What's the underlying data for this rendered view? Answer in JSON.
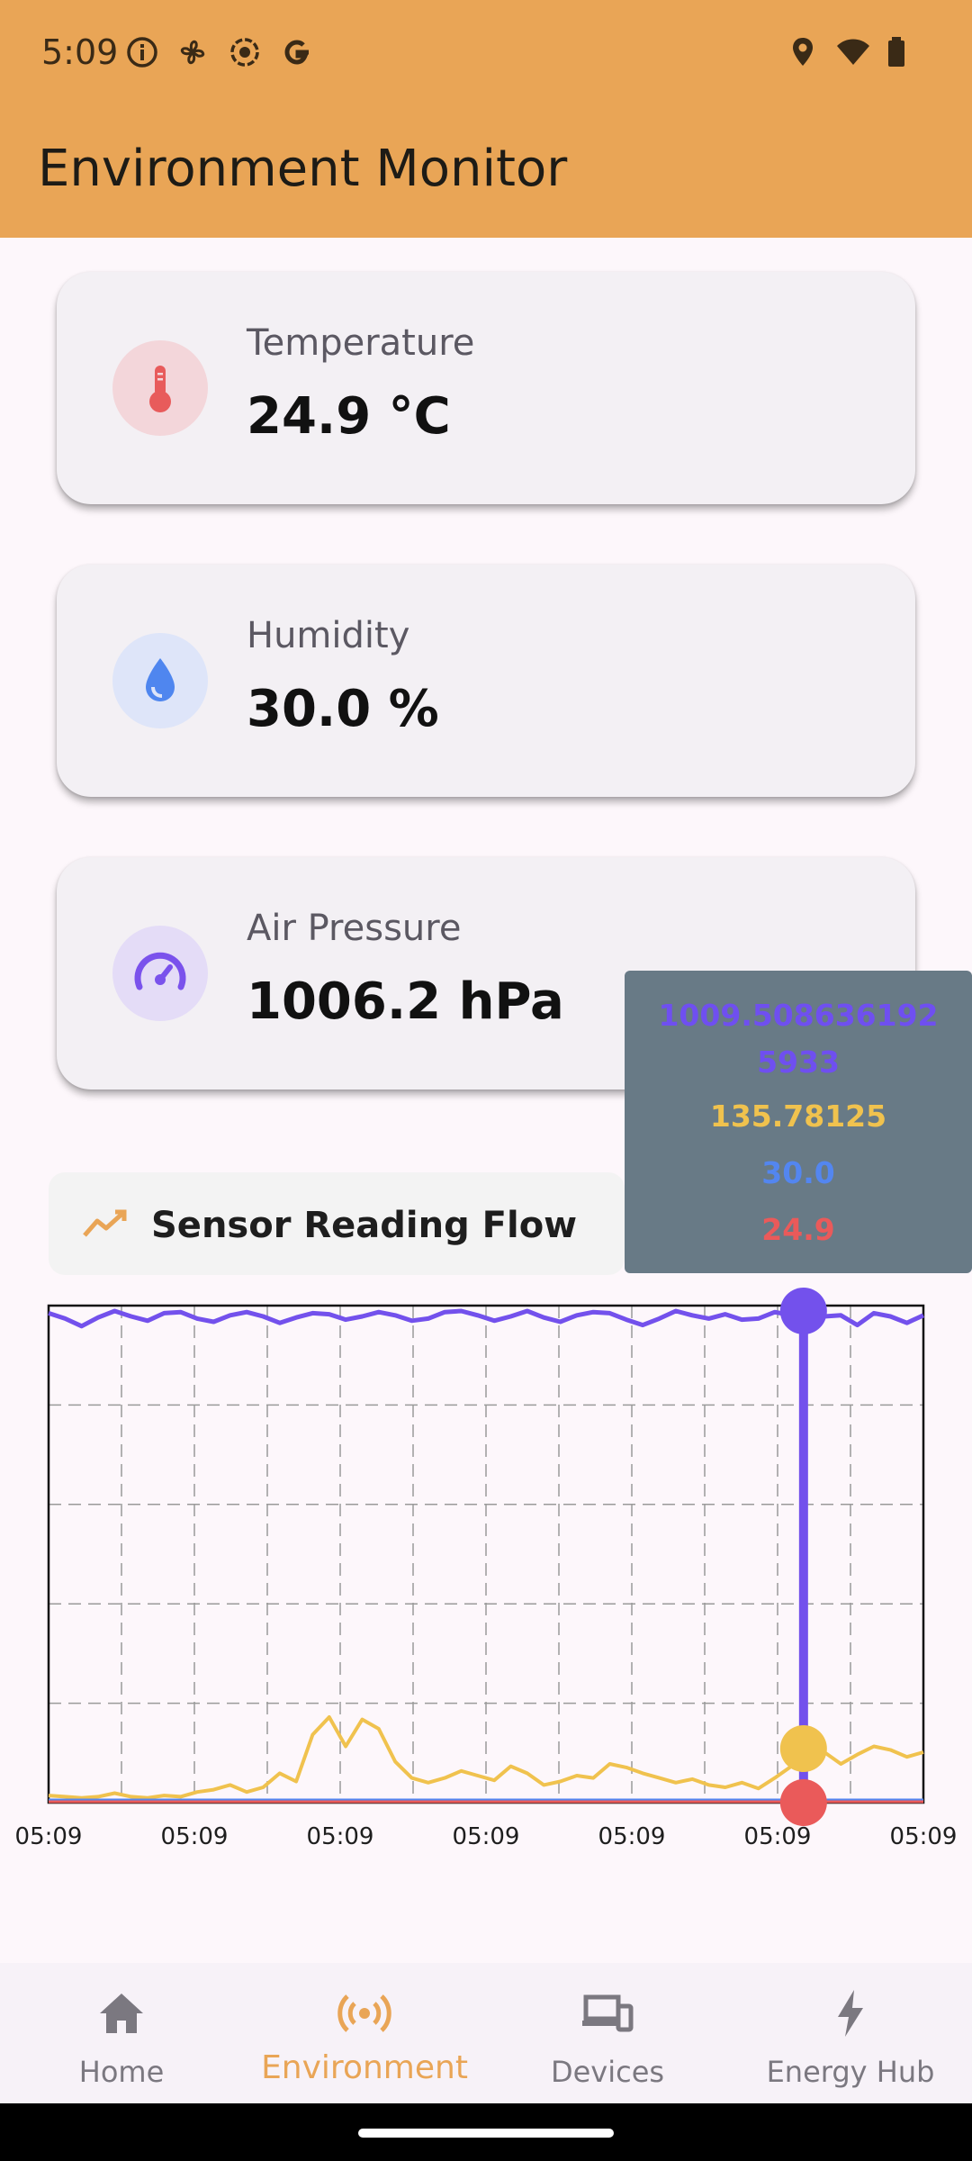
{
  "status_bar": {
    "time": "5:09",
    "left_icons": [
      "info-icon",
      "fan-icon",
      "record-icon",
      "google-icon"
    ],
    "right_icons": [
      "location-icon",
      "wifi-icon",
      "battery-icon"
    ]
  },
  "app_bar": {
    "title": "Environment Monitor",
    "color": "#e9a556"
  },
  "cards": [
    {
      "label": "Temperature",
      "value": "24.9 °C",
      "icon": "thermometer-icon",
      "accent": "#e85b5b"
    },
    {
      "label": "Humidity",
      "value": "30.0 %",
      "icon": "water-drop-icon",
      "accent": "#4f86ef"
    },
    {
      "label": "Air Pressure",
      "value": "1006.2 hPa",
      "icon": "speedometer-icon",
      "accent": "#7a52ec"
    }
  ],
  "flow_section": {
    "title": "Sensor Reading Flow",
    "icon": "trending-icon"
  },
  "tooltip": {
    "lines": [
      {
        "text": "1009.508636192\n5933",
        "color": "#6f4ff0"
      },
      {
        "text": "135.78125",
        "color": "#f0c24e"
      },
      {
        "text": "30.0",
        "color": "#5386f0"
      },
      {
        "text": "24.9",
        "color": "#ea5a5a"
      }
    ]
  },
  "chart_data": {
    "type": "line",
    "x_tick_labels": [
      "05:09",
      "05:09",
      "05:09",
      "05:09",
      "05:09",
      "05:09",
      "05:09"
    ],
    "series": [
      {
        "color": "#7351ec",
        "values": [
          1008.4,
          1008.9,
          1009.6,
          1008.8,
          1008.2,
          1008.7,
          1009.1,
          1008.4,
          1008.3,
          1008.9,
          1009.2,
          1008.6,
          1008.3,
          1008.7,
          1009.3,
          1008.8,
          1008.4,
          1008.5,
          1009.0,
          1008.7,
          1008.3,
          1008.6,
          1009.1,
          1008.9,
          1008.3,
          1008.2,
          1008.6,
          1009.1,
          1008.7,
          1008.2,
          1008.8,
          1009.2,
          1008.6,
          1008.3,
          1008.4,
          1009.0,
          1009.5,
          1008.9,
          1008.2,
          1008.6,
          1008.9,
          1008.5,
          1009.0,
          1008.9,
          1008.3,
          1008.6,
          1009.0,
          1008.7,
          1008.6,
          1009.5,
          1008.4,
          1008.7,
          1009.3,
          1008.6
        ]
      },
      {
        "color": "#f0c24e",
        "values": [
          3,
          2,
          1,
          2,
          5,
          2,
          1,
          3,
          2,
          6,
          8,
          12,
          6,
          10,
          22,
          15,
          55,
          70,
          45,
          68,
          60,
          32,
          18,
          14,
          18,
          24,
          20,
          16,
          28,
          22,
          12,
          15,
          20,
          18,
          30,
          27,
          22,
          18,
          14,
          17,
          12,
          10,
          14,
          9,
          18,
          28,
          35,
          40,
          30,
          38,
          45,
          42,
          36,
          40
        ]
      },
      {
        "color": "#5386f0",
        "values": [
          1,
          1,
          1,
          1,
          1,
          1,
          1,
          1,
          1,
          1,
          1,
          1
        ]
      },
      {
        "color": "#ea5a5a",
        "values": [
          0,
          0,
          0,
          0,
          0,
          0,
          0,
          0,
          0,
          0,
          0,
          0
        ]
      }
    ],
    "grid": true,
    "selected_x_fraction": 0.863,
    "selected_points": [
      {
        "series": 0,
        "value": 1009.5086361925933
      },
      {
        "series": 1,
        "value": 135.78125
      },
      {
        "series": 2,
        "value": 30.0
      },
      {
        "series": 3,
        "value": 24.9
      }
    ]
  },
  "bottom_nav": {
    "items": [
      {
        "label": "Home",
        "icon": "home-icon",
        "active": false
      },
      {
        "label": "Environment",
        "icon": "broadcast-icon",
        "active": true
      },
      {
        "label": "Devices",
        "icon": "devices-icon",
        "active": false
      },
      {
        "label": "Energy Hub",
        "icon": "bolt-icon",
        "active": false
      }
    ]
  }
}
